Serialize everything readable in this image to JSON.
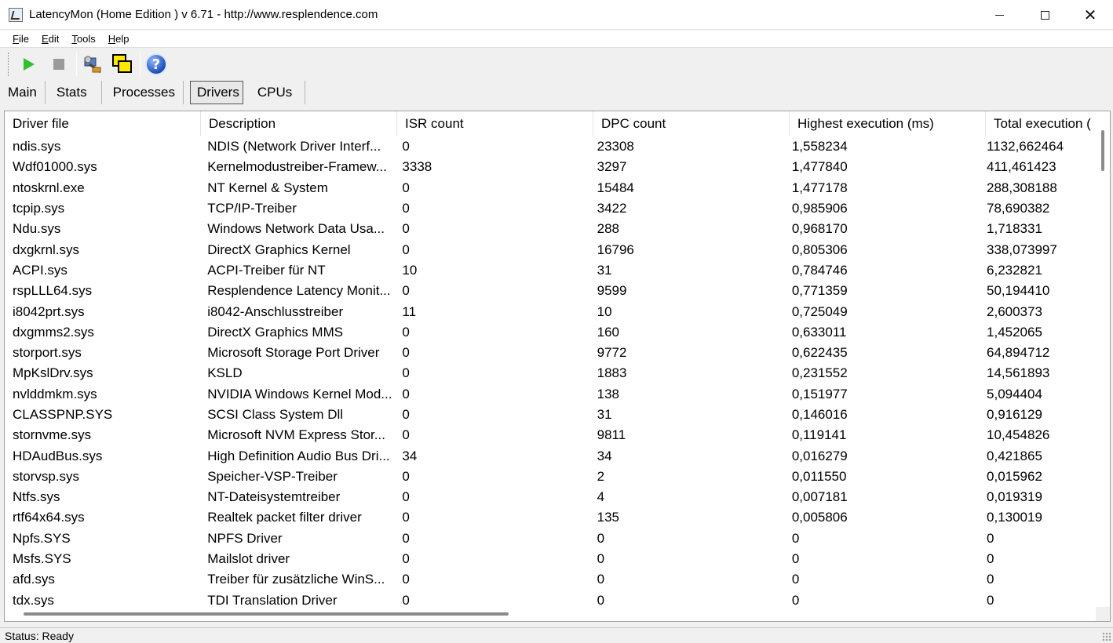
{
  "window": {
    "title": "LatencyMon  (Home Edition )  v 6.71 - http://www.resplendence.com"
  },
  "menu": [
    {
      "pre": "",
      "ul": "F",
      "post": "ile"
    },
    {
      "pre": "",
      "ul": "E",
      "post": "dit"
    },
    {
      "pre": "",
      "ul": "T",
      "post": "ools"
    },
    {
      "pre": "",
      "ul": "H",
      "post": "elp"
    }
  ],
  "toolbar": {
    "icons": [
      "play-icon",
      "stop-icon",
      "tools-icon",
      "windows-icon",
      "help-icon"
    ]
  },
  "tabs": {
    "main": "Main",
    "stats": "Stats",
    "processes": "Processes",
    "drivers": "Drivers",
    "cpus": "CPUs",
    "active": "Drivers"
  },
  "table": {
    "headers": [
      "Driver file",
      "Description",
      "ISR count",
      "DPC count",
      "Highest execution (ms)",
      "Total execution ("
    ],
    "rows": [
      [
        "ndis.sys",
        "NDIS (Network Driver Interf...",
        "0",
        "23308",
        "1,558234",
        "1132,662464"
      ],
      [
        "Wdf01000.sys",
        "Kernelmodustreiber-Framew...",
        "3338",
        "3297",
        "1,477840",
        "411,461423"
      ],
      [
        "ntoskrnl.exe",
        "NT Kernel & System",
        "0",
        "15484",
        "1,477178",
        "288,308188"
      ],
      [
        "tcpip.sys",
        "TCP/IP-Treiber",
        "0",
        "3422",
        "0,985906",
        "78,690382"
      ],
      [
        "Ndu.sys",
        "Windows Network Data Usa...",
        "0",
        "288",
        "0,968170",
        "1,718331"
      ],
      [
        "dxgkrnl.sys",
        "DirectX Graphics Kernel",
        "0",
        "16796",
        "0,805306",
        "338,073997"
      ],
      [
        "ACPI.sys",
        "ACPI-Treiber für NT",
        "10",
        "31",
        "0,784746",
        "6,232821"
      ],
      [
        "rspLLL64.sys",
        "Resplendence Latency Monit...",
        "0",
        "9599",
        "0,771359",
        "50,194410"
      ],
      [
        "i8042prt.sys",
        "i8042-Anschlusstreiber",
        "11",
        "10",
        "0,725049",
        "2,600373"
      ],
      [
        "dxgmms2.sys",
        "DirectX Graphics MMS",
        "0",
        "160",
        "0,633011",
        "1,452065"
      ],
      [
        "storport.sys",
        "Microsoft Storage Port Driver",
        "0",
        "9772",
        "0,622435",
        "64,894712"
      ],
      [
        "MpKslDrv.sys",
        "KSLD",
        "0",
        "1883",
        "0,231552",
        "14,561893"
      ],
      [
        "nvlddmkm.sys",
        "NVIDIA Windows Kernel Mod...",
        "0",
        "138",
        "0,151977",
        "5,094404"
      ],
      [
        "CLASSPNP.SYS",
        "SCSI Class System Dll",
        "0",
        "31",
        "0,146016",
        "0,916129"
      ],
      [
        "stornvme.sys",
        "Microsoft NVM Express Stor...",
        "0",
        "9811",
        "0,119141",
        "10,454826"
      ],
      [
        "HDAudBus.sys",
        "High Definition Audio Bus Dri...",
        "34",
        "34",
        "0,016279",
        "0,421865"
      ],
      [
        "storvsp.sys",
        "Speicher-VSP-Treiber",
        "0",
        "2",
        "0,011550",
        "0,015962"
      ],
      [
        "Ntfs.sys",
        "NT-Dateisystemtreiber",
        "0",
        "4",
        "0,007181",
        "0,019319"
      ],
      [
        "rtf64x64.sys",
        "Realtek packet filter driver",
        "0",
        "135",
        "0,005806",
        "0,130019"
      ],
      [
        "Npfs.SYS",
        "NPFS Driver",
        "0",
        "0",
        "0",
        "0"
      ],
      [
        "Msfs.SYS",
        "Mailslot driver",
        "0",
        "0",
        "0",
        "0"
      ],
      [
        "afd.sys",
        "Treiber für zusätzliche WinS...",
        "0",
        "0",
        "0",
        "0"
      ],
      [
        "tdx.sys",
        "TDI Translation Driver",
        "0",
        "0",
        "0",
        "0"
      ]
    ]
  },
  "status": {
    "text": "Status: Ready"
  }
}
